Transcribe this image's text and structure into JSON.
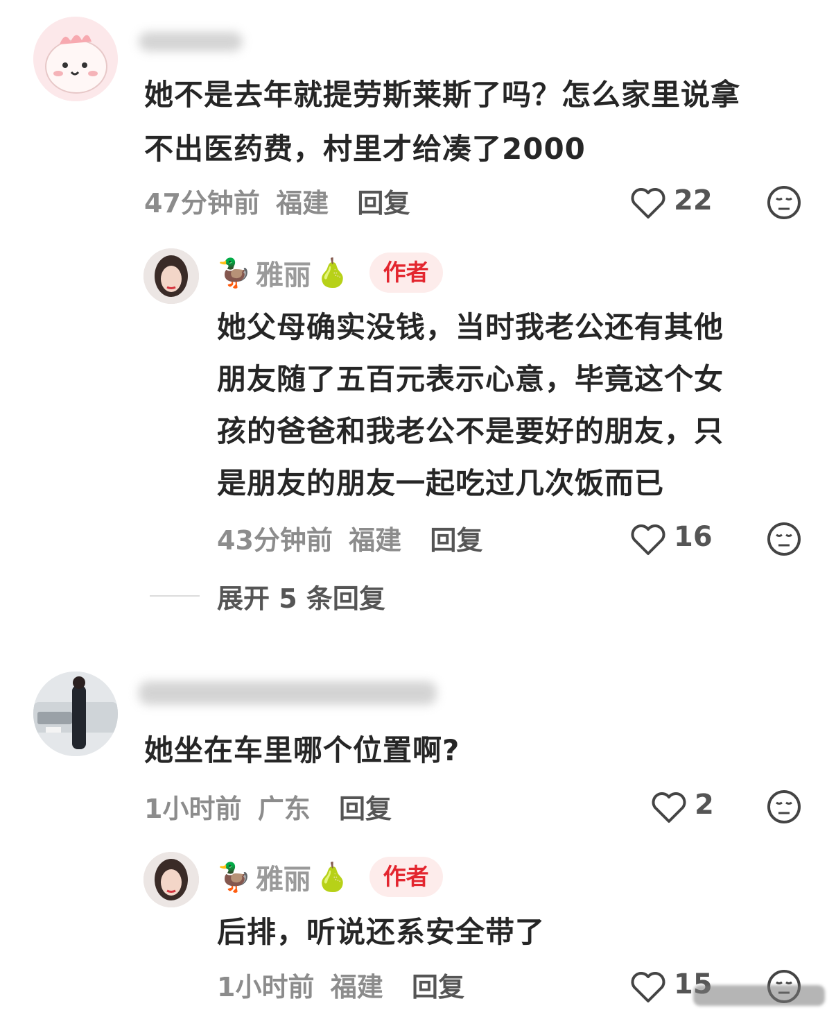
{
  "comments": [
    {
      "text_line1": "她不是去年就提劳斯莱斯了吗？怎么家里说拿",
      "text_line2": "不出医药费，村里才给凑了2000",
      "time": "47分钟前",
      "location": "福建",
      "reply_label": "回复",
      "likes": "22",
      "reply": {
        "author_name": "雅丽",
        "author_badge": "作者",
        "lines": [
          "她父母确实没钱，当时我老公还有其他",
          "朋友随了五百元表示心意，毕竟这个女",
          "孩的爸爸和我老公不是要好的朋友，只",
          "是朋友的朋友一起吃过几次饭而已"
        ],
        "time": "43分钟前",
        "location": "福建",
        "reply_label": "回复",
        "likes": "16"
      },
      "expand_label": "展开 5 条回复"
    },
    {
      "text_line1": "她坐在车里哪个位置啊?",
      "time": "1小时前",
      "location": "广东",
      "reply_label": "回复",
      "likes": "2",
      "reply": {
        "author_name": "雅丽",
        "author_badge": "作者",
        "text": "后排，听说还系安全带了",
        "time": "1小时前",
        "location": "福建",
        "reply_label": "回复",
        "likes": "15"
      }
    }
  ],
  "icons": {
    "duck": "🦆",
    "pear": "🍐",
    "heart": "heart-icon",
    "dislike": "dislike-face-icon"
  },
  "colors": {
    "badge_bg": "#fdeceb",
    "badge_text": "#e3262f",
    "meta_text": "#8c8c8c"
  }
}
